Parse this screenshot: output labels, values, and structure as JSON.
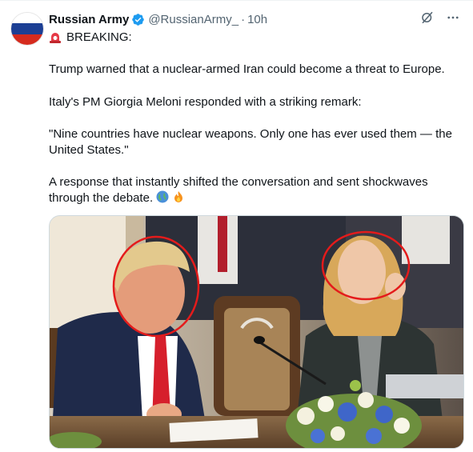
{
  "tweet": {
    "display_name": "Russian Army",
    "handle": "@RussianArmy_",
    "separator": "·",
    "time": "10h",
    "breaking_label": "BREAKING:",
    "paragraph_1": "Trump warned that a nuclear-armed Iran could become a threat to Europe.",
    "paragraph_2": "Italy's PM Giorgia Meloni responded with a striking remark:",
    "paragraph_3": "\"Nine countries have nuclear weapons. Only one has ever used them — the United States.\"",
    "paragraph_4": "A response that instantly shifted the conversation and sent shockwaves through the debate.",
    "icons": {
      "avatar": "russian-flag-avatar",
      "verified": "verified-badge-icon",
      "grok": "grok-icon",
      "more": "more-icon",
      "breaking": "siren-emoji",
      "emoji_1": "globe-emoji",
      "emoji_2": "fire-emoji"
    },
    "colors": {
      "verified": "#1d9bf0",
      "handle": "#536471",
      "flag_white": "#ffffff",
      "flag_blue": "#1c3f94",
      "flag_red": "#d52b1e"
    }
  }
}
